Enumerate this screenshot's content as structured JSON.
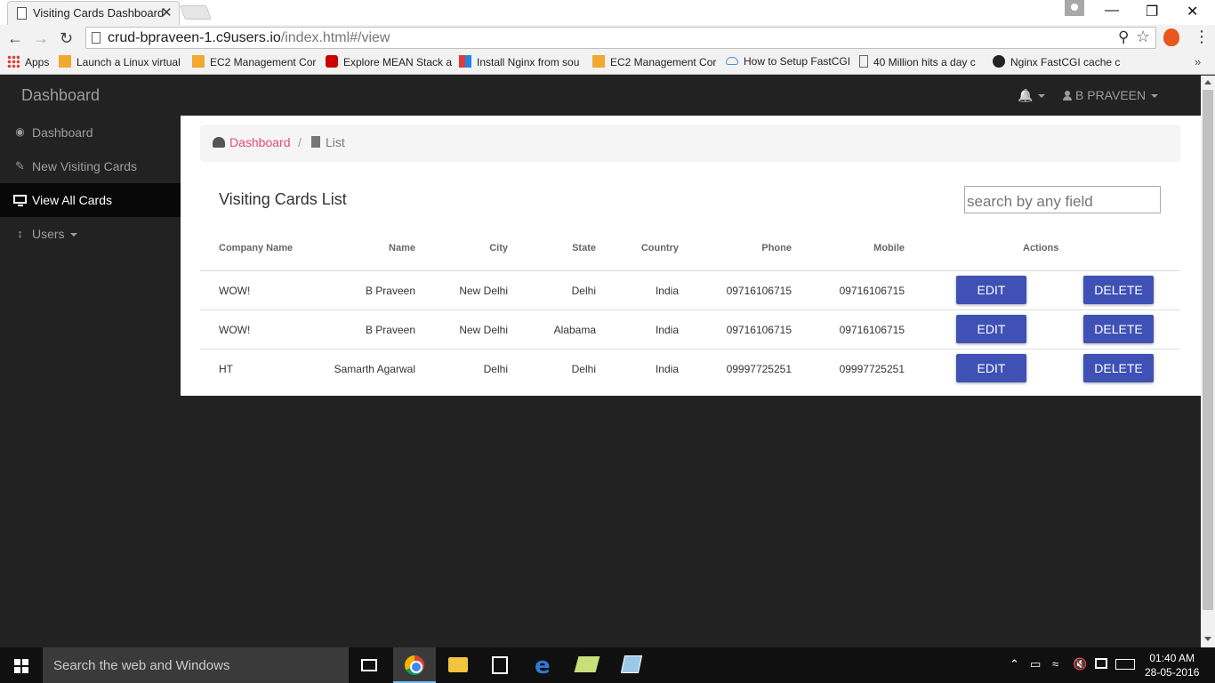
{
  "browser": {
    "tab_title": "Visiting Cards Dashboard",
    "tab_close": "✕",
    "url_host": "crud-bpraveen-1.c9users.io",
    "url_path": "/index.html#/view",
    "win_minimize": "—",
    "win_restore": "❐",
    "win_close": "✕",
    "bookmarks": [
      {
        "label": "Apps"
      },
      {
        "label": "Launch a Linux virtual"
      },
      {
        "label": "EC2 Management Cor"
      },
      {
        "label": "Explore MEAN Stack a"
      },
      {
        "label": "Install Nginx from sou"
      },
      {
        "label": "EC2 Management Cor"
      },
      {
        "label": "How to Setup FastCGI"
      },
      {
        "label": "40 Million hits a day c"
      },
      {
        "label": "Nginx FastCGI cache c"
      }
    ],
    "bookmarks_more": "»"
  },
  "header": {
    "brand": "Dashboard",
    "bell": "🔔",
    "user": "B PRAVEEN"
  },
  "sidebar": {
    "items": [
      {
        "label": "Dashboard",
        "icon": "🎨"
      },
      {
        "label": "New Visiting Cards",
        "icon": "✎"
      },
      {
        "label": "View All Cards",
        "icon": "monitor"
      },
      {
        "label": "Users",
        "icon": "↕"
      }
    ]
  },
  "breadcrumb": {
    "home": "Dashboard",
    "separator": "/",
    "current": "List"
  },
  "list": {
    "title": "Visiting Cards List",
    "search_placeholder": "search by any field"
  },
  "table": {
    "headers": {
      "company": "Company Name",
      "name": "Name",
      "city": "City",
      "state": "State",
      "country": "Country",
      "phone": "Phone",
      "mobile": "Mobile",
      "actions": "Actions"
    },
    "edit_label": "EDIT",
    "delete_label": "DELETE",
    "rows": [
      {
        "company": "WOW!",
        "name": "B Praveen",
        "city": "New Delhi",
        "state": "Delhi",
        "country": "India",
        "phone": "09716106715",
        "mobile": "09716106715"
      },
      {
        "company": "WOW!",
        "name": "B Praveen",
        "city": "New Delhi",
        "state": "Alabama",
        "country": "India",
        "phone": "09716106715",
        "mobile": "09716106715"
      },
      {
        "company": "HT",
        "name": "Samarth Agarwal",
        "city": "Delhi",
        "state": "Delhi",
        "country": "India",
        "phone": "09997725251",
        "mobile": "09997725251"
      }
    ]
  },
  "taskbar": {
    "search_text": "Search the web and Windows",
    "time": "01:40 AM",
    "date": "28-05-2016"
  },
  "colors": {
    "accent_button": "#3f51b5",
    "breadcrumb_link": "#e84a6f",
    "sidebar_bg": "#222222",
    "sidebar_active": "#080808"
  }
}
